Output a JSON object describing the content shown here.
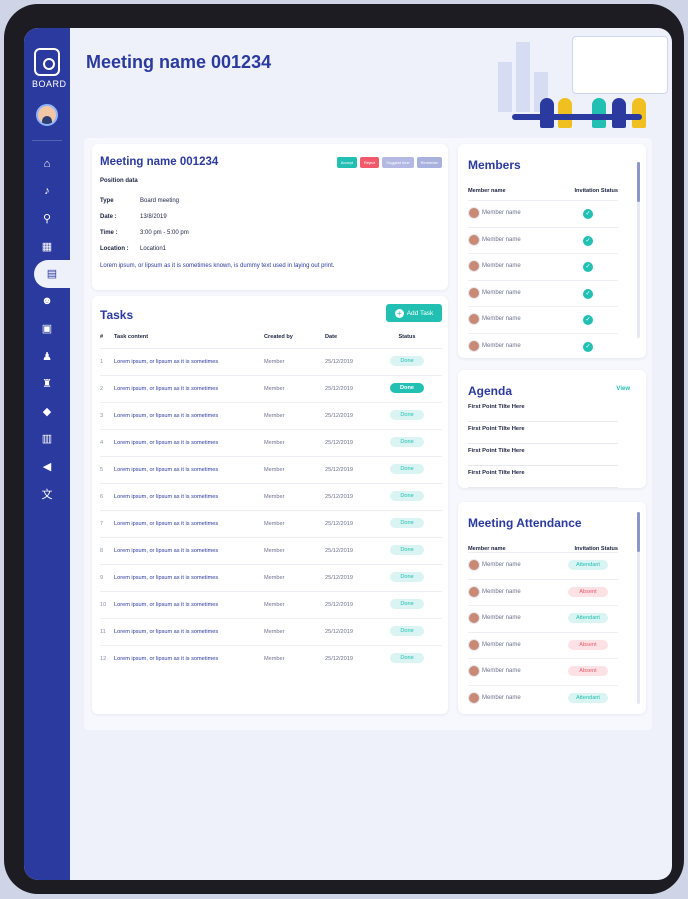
{
  "brand": {
    "logo_text": "BOARD"
  },
  "page_title": "Meeting name  001234",
  "sidebar": {
    "items": [
      {
        "name": "home",
        "icon": "⌂"
      },
      {
        "name": "notifications",
        "icon": "♪"
      },
      {
        "name": "search",
        "icon": "⚲"
      },
      {
        "name": "dashboard",
        "icon": "▦"
      },
      {
        "name": "meetings",
        "icon": "▤",
        "active": true
      },
      {
        "name": "users",
        "icon": "☻"
      },
      {
        "name": "documents",
        "icon": "▣"
      },
      {
        "name": "profile",
        "icon": "♟"
      },
      {
        "name": "committee",
        "icon": "♜"
      },
      {
        "name": "tags",
        "icon": "◆"
      },
      {
        "name": "files",
        "icon": "▥"
      },
      {
        "name": "announcements",
        "icon": "◀"
      },
      {
        "name": "translate",
        "icon": "文"
      }
    ]
  },
  "meeting": {
    "title": "Meeting name  001234",
    "buttons": {
      "accept": "Accept",
      "reject": "Reject",
      "suggest": "Suggest time",
      "reminder": "Reminder"
    },
    "position_label": "Position data",
    "fields": [
      {
        "k": "Type",
        "v": "Board meeting"
      },
      {
        "k": "Date :",
        "v": "13/8/2019"
      },
      {
        "k": "Time :",
        "v": "3:00 pm - 5:00 pm"
      },
      {
        "k": "Location :",
        "v": "Location1"
      }
    ],
    "description": "Lorem ipsum, or lipsum as it is sometimes known, is dummy text used in laying out print."
  },
  "tasks": {
    "title": "Tasks",
    "add_label": "Add Task",
    "headers": {
      "num": "#",
      "content": "Task content",
      "created_by": "Created by",
      "date": "Date",
      "status": "Status"
    },
    "rows": [
      {
        "n": "1",
        "content": "Lorem ipsum, or lipsum as it is sometimes",
        "by": "Member",
        "date": "25/12/2019",
        "status": "Done",
        "highlight": false
      },
      {
        "n": "2",
        "content": "Lorem ipsum, or lipsum as it is sometimes",
        "by": "Member",
        "date": "25/12/2019",
        "status": "Done",
        "highlight": true
      },
      {
        "n": "3",
        "content": "Lorem ipsum, or lipsum as it is sometimes",
        "by": "Member",
        "date": "25/12/2019",
        "status": "Done",
        "highlight": false
      },
      {
        "n": "4",
        "content": "Lorem ipsum, or lipsum as it is sometimes",
        "by": "Member",
        "date": "25/12/2019",
        "status": "Done",
        "highlight": false
      },
      {
        "n": "5",
        "content": "Lorem ipsum, or lipsum as it is sometimes",
        "by": "Member",
        "date": "25/12/2019",
        "status": "Done",
        "highlight": false
      },
      {
        "n": "6",
        "content": "Lorem ipsum, or lipsum as it is sometimes",
        "by": "Member",
        "date": "25/12/2019",
        "status": "Done",
        "highlight": false
      },
      {
        "n": "7",
        "content": "Lorem ipsum, or lipsum as it is sometimes",
        "by": "Member",
        "date": "25/12/2019",
        "status": "Done",
        "highlight": false
      },
      {
        "n": "8",
        "content": "Lorem ipsum, or lipsum as it is sometimes",
        "by": "Member",
        "date": "25/12/2019",
        "status": "Done",
        "highlight": false
      },
      {
        "n": "9",
        "content": "Lorem ipsum, or lipsum as it is sometimes",
        "by": "Member",
        "date": "25/12/2019",
        "status": "Done",
        "highlight": false
      },
      {
        "n": "10",
        "content": "Lorem ipsum, or lipsum as it is sometimes",
        "by": "Member",
        "date": "25/12/2019",
        "status": "Done",
        "highlight": false
      },
      {
        "n": "11",
        "content": "Lorem ipsum, or lipsum as it is sometimes",
        "by": "Member",
        "date": "25/12/2019",
        "status": "Done",
        "highlight": false
      },
      {
        "n": "12",
        "content": "Lorem ipsum, or lipsum as it is sometimes",
        "by": "Member",
        "date": "25/12/2019",
        "status": "Done",
        "highlight": false
      }
    ]
  },
  "members": {
    "title": "Members",
    "col_name": "Member name",
    "col_status": "Invitation Status",
    "rows": [
      "Member name",
      "Member name",
      "Member name",
      "Member name",
      "Member name",
      "Member name"
    ]
  },
  "agenda": {
    "title": "Agenda",
    "view_label": "View",
    "items": [
      "First Point Tilte Here",
      "First Point Tilte Here",
      "First Point Tilte Here",
      "First Point Tilte Here"
    ]
  },
  "attendance": {
    "title": "Meeting Attendance",
    "col_name": "Member name",
    "col_status": "Invitation Status",
    "rows": [
      {
        "name": "Member name",
        "status": "Attendant"
      },
      {
        "name": "Member name",
        "status": "Absent"
      },
      {
        "name": "Member name",
        "status": "Attendant"
      },
      {
        "name": "Member name",
        "status": "Absent"
      },
      {
        "name": "Member name",
        "status": "Absent"
      },
      {
        "name": "Member name",
        "status": "Attendant"
      }
    ]
  },
  "colors": {
    "primary": "#2b3a9e",
    "accent": "#21c0b2",
    "danger": "#f05a6a"
  }
}
